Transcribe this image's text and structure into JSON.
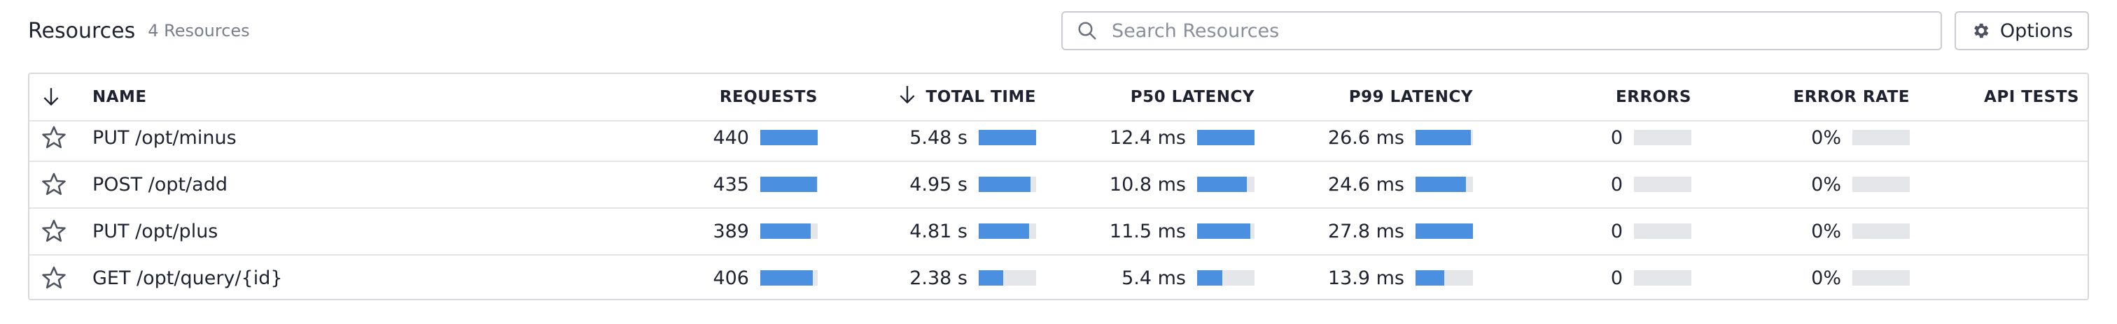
{
  "header": {
    "title": "Resources",
    "count": "4 Resources",
    "search_placeholder": "Search Resources",
    "options_label": "Options"
  },
  "columns": {
    "name": "NAME",
    "requests": "REQUESTS",
    "total_time": "TOTAL TIME",
    "p50": "P50 LATENCY",
    "p99": "P99 LATENCY",
    "errors": "ERRORS",
    "error_rate": "ERROR RATE",
    "api_tests": "API TESTS"
  },
  "rows": [
    {
      "name": "PUT /opt/minus",
      "requests": "440",
      "total_time": "5.48 s",
      "p50": "12.4 ms",
      "p99": "26.6 ms",
      "errors": "0",
      "error_rate": "0%",
      "fills": {
        "requests": 1.0,
        "total_time": 1.0,
        "p50": 1.0,
        "p99": 0.96,
        "errors": 0,
        "error_rate": 0
      }
    },
    {
      "name": "POST /opt/add",
      "requests": "435",
      "total_time": "4.95 s",
      "p50": "10.8 ms",
      "p99": "24.6 ms",
      "errors": "0",
      "error_rate": "0%",
      "fills": {
        "requests": 0.99,
        "total_time": 0.9,
        "p50": 0.87,
        "p99": 0.88,
        "errors": 0,
        "error_rate": 0
      }
    },
    {
      "name": "PUT /opt/plus",
      "requests": "389",
      "total_time": "4.81 s",
      "p50": "11.5 ms",
      "p99": "27.8 ms",
      "errors": "0",
      "error_rate": "0%",
      "fills": {
        "requests": 0.88,
        "total_time": 0.88,
        "p50": 0.93,
        "p99": 1.0,
        "errors": 0,
        "error_rate": 0
      }
    },
    {
      "name": "GET /opt/query/{id}",
      "requests": "406",
      "total_time": "2.38 s",
      "p50": "5.4 ms",
      "p99": "13.9 ms",
      "errors": "0",
      "error_rate": "0%",
      "fills": {
        "requests": 0.92,
        "total_time": 0.43,
        "p50": 0.44,
        "p99": 0.5,
        "errors": 0,
        "error_rate": 0
      }
    }
  ],
  "colors": {
    "bar_fill": "#4a8fe0",
    "bar_track": "#e4e6ea"
  }
}
